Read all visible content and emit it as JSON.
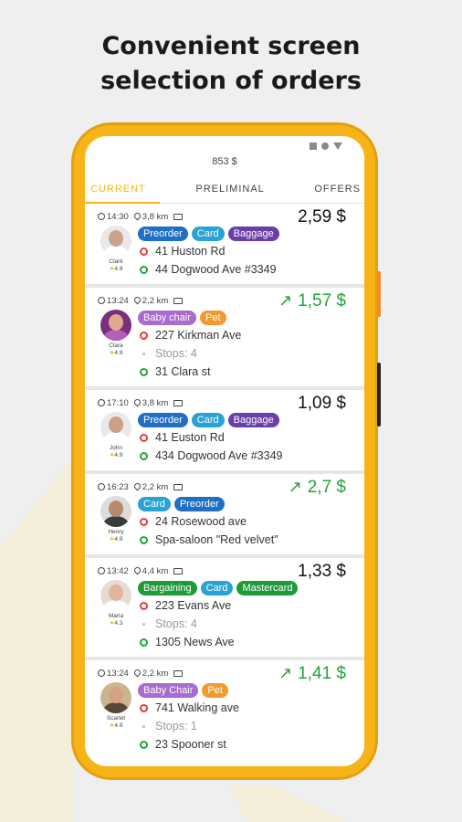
{
  "headline": {
    "line1": "Convenient screen",
    "line2": "selection of orders"
  },
  "balance": "853 $",
  "tabs": [
    {
      "label": "CURRENT",
      "active": true
    },
    {
      "label": "PRELIMINAL",
      "active": false
    },
    {
      "label": "OFFERS",
      "active": false
    }
  ],
  "colors": {
    "accent": "#f7b418",
    "blue": "#1f6fc3",
    "lightblue": "#2aa2d6",
    "purple": "#6a3fa8",
    "lilac": "#a86bd0",
    "orange": "#f29a2e",
    "green": "#1e9a3a"
  },
  "orders": [
    {
      "time": "14:30",
      "distance": "3,8 km",
      "price": "2,59 $",
      "price_up": false,
      "user": {
        "name": "Clark",
        "rating": "4.9"
      },
      "tags": [
        {
          "label": "Preorder",
          "color": "#1f6fc3"
        },
        {
          "label": "Card",
          "color": "#2aa2d6"
        },
        {
          "label": "Baggage",
          "color": "#6a3fa8"
        }
      ],
      "from": "41 Huston Rd",
      "stops": "",
      "to": "44 Dogwood Ave #3349"
    },
    {
      "time": "13:24",
      "distance": "2,2 km",
      "price": "1,57 $",
      "price_up": true,
      "user": {
        "name": "Clara",
        "rating": "4.9"
      },
      "tags": [
        {
          "label": "Baby chair",
          "color": "#a86bd0"
        },
        {
          "label": "Pet",
          "color": "#f29a2e"
        }
      ],
      "from": "227 Kirkman Ave",
      "stops": "Stops: 4",
      "to": "31 Clara st"
    },
    {
      "time": "17:10",
      "distance": "3,8 km",
      "price": "1,09 $",
      "price_up": false,
      "user": {
        "name": "John",
        "rating": "4.9"
      },
      "tags": [
        {
          "label": "Preorder",
          "color": "#1f6fc3"
        },
        {
          "label": "Card",
          "color": "#2aa2d6"
        },
        {
          "label": "Baggage",
          "color": "#6a3fa8"
        }
      ],
      "from": "41 Euston Rd",
      "stops": "",
      "to": "434 Dogwood Ave #3349"
    },
    {
      "time": "16:23",
      "distance": "2,2 km",
      "price": "2,7 $",
      "price_up": true,
      "user": {
        "name": "Henry",
        "rating": "4.9"
      },
      "tags": [
        {
          "label": "Card",
          "color": "#2aa2d6"
        },
        {
          "label": "Preorder",
          "color": "#1f6fc3"
        }
      ],
      "from": "24 Rosewood ave",
      "stops": "",
      "to": "Spa-saloon \"Red velvet\""
    },
    {
      "time": "13:42",
      "distance": "4,4 km",
      "price": "1,33 $",
      "price_up": false,
      "user": {
        "name": "Maria",
        "rating": "4.3"
      },
      "tags": [
        {
          "label": "Bargaining",
          "color": "#1e9a3a"
        },
        {
          "label": "Card",
          "color": "#2aa2d6"
        },
        {
          "label": "Mastercard",
          "color": "#1e9a3a"
        }
      ],
      "from": "223 Evans Ave",
      "stops": "Stops: 4",
      "to": "1305 News Ave"
    },
    {
      "time": "13:24",
      "distance": "2,2 km",
      "price": "1,41 $",
      "price_up": true,
      "user": {
        "name": "Scarlet",
        "rating": "4.9"
      },
      "tags": [
        {
          "label": "Baby Chair",
          "color": "#a86bd0"
        },
        {
          "label": "Pet",
          "color": "#f29a2e"
        }
      ],
      "from": "741 Walking ave",
      "stops": "Stops: 1",
      "to": "23 Spooner st"
    }
  ]
}
